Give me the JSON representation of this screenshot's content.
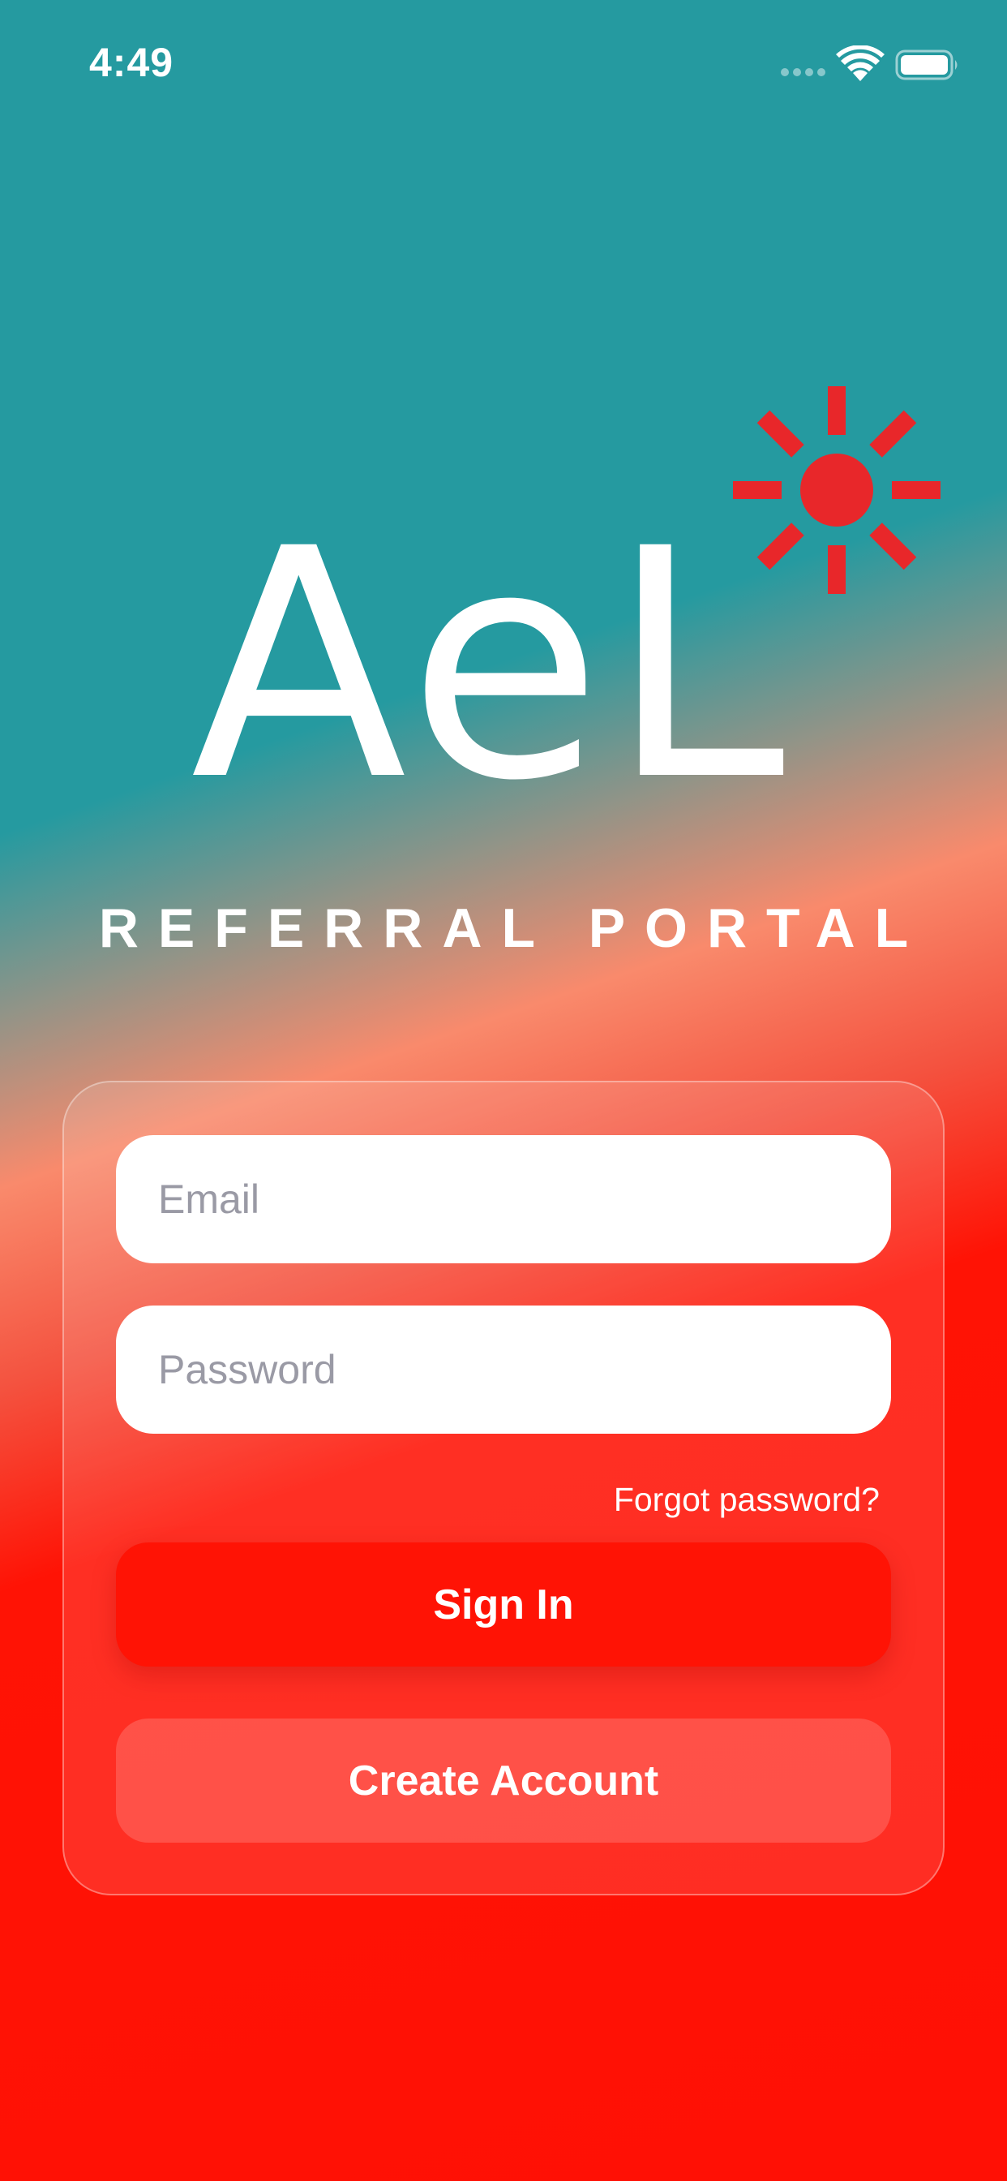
{
  "status_bar": {
    "time": "4:49",
    "icons": [
      "cellular-signal-icon",
      "wifi-icon",
      "battery-icon"
    ]
  },
  "brand": {
    "wordmark": "AeL",
    "logo_icon": "sun-icon",
    "logo_color": "#e8272a",
    "subtitle": "REFERRAL PORTAL"
  },
  "login": {
    "email_placeholder": "Email",
    "email_value": "",
    "password_placeholder": "Password",
    "password_value": "",
    "forgot_password": "Forgot password?",
    "sign_in": "Sign In",
    "create_account": "Create Account"
  },
  "colors": {
    "teal": "#259aa0",
    "red": "#ff1305",
    "placeholder": "#9a9aa5"
  }
}
